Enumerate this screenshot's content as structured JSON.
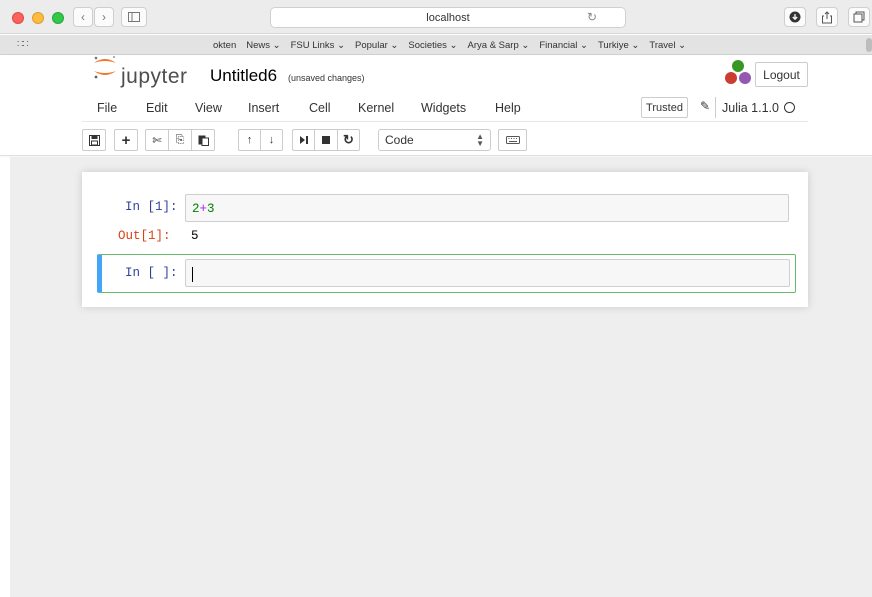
{
  "browser": {
    "url": "localhost",
    "bookmarks": [
      "okten",
      "News ⌄",
      "FSU Links ⌄",
      "Popular ⌄",
      "Societies ⌄",
      "Arya & Sarp ⌄",
      "Financial ⌄",
      "Turkiye ⌄",
      "Travel ⌄"
    ]
  },
  "jupyter": {
    "logo_text": "jupyter",
    "notebook_title": "Untitled6",
    "save_status": "(unsaved changes)",
    "logout_label": "Logout",
    "menu": [
      "File",
      "Edit",
      "View",
      "Insert",
      "Cell",
      "Kernel",
      "Widgets",
      "Help"
    ],
    "trusted_label": "Trusted",
    "kernel_name": "Julia 1.1.0",
    "cell_type": "Code"
  },
  "cells": {
    "cell1": {
      "in_prompt": "In [1]:",
      "code_a": "2",
      "code_op": "+",
      "code_b": "3",
      "out_prompt": "Out[1]:",
      "output": "5"
    },
    "cell2": {
      "in_prompt": "In [ ]:",
      "code": ""
    }
  },
  "colors": {
    "in_prompt": "#303f9f",
    "out_prompt": "#d84315",
    "selected_border": "#66bb6a",
    "selected_bar": "#42a5f5"
  }
}
